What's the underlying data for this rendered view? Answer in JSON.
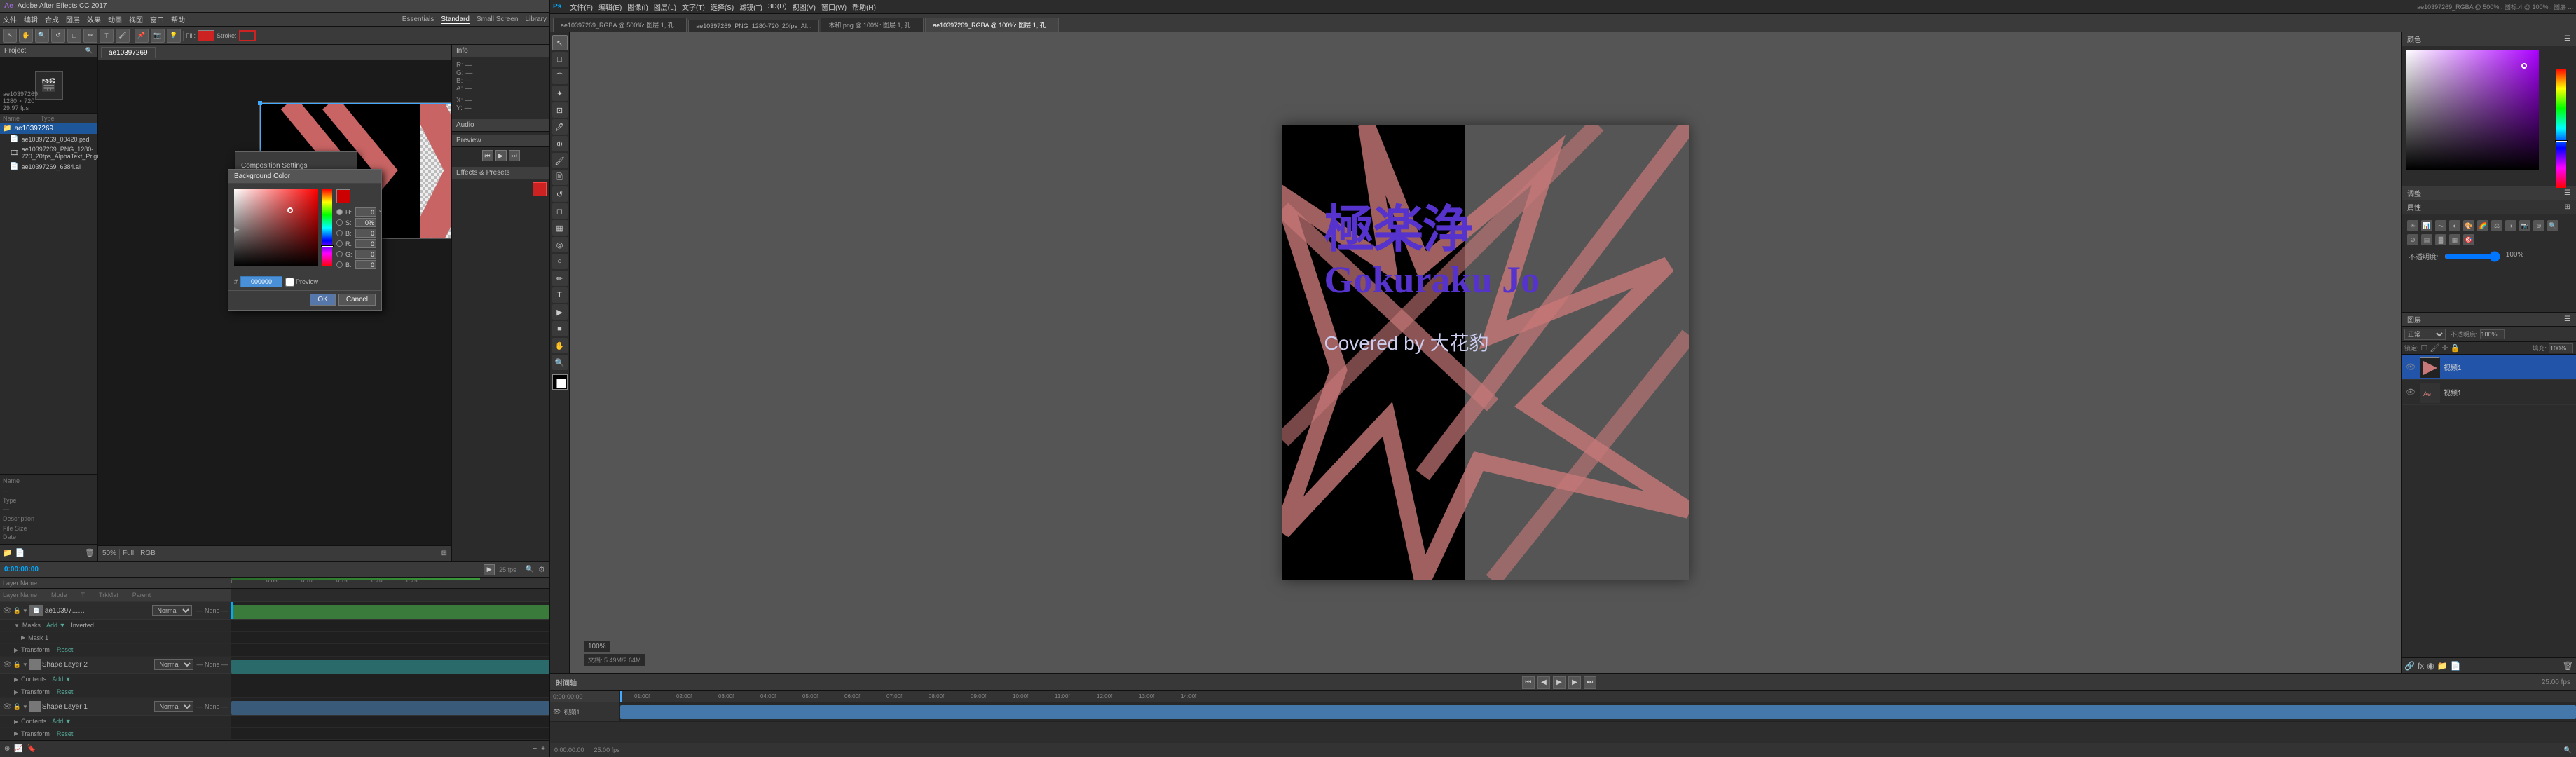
{
  "ae": {
    "title": "Adobe After Effects CC 2017",
    "menu": [
      "文件",
      "编辑",
      "合成",
      "图层",
      "效果",
      "动画",
      "视图",
      "窗口",
      "帮助"
    ],
    "tabs": {
      "project": "ae10397269",
      "comp": "ae10397269"
    },
    "toolbar_label": "Essentials",
    "workspace_options": [
      "Essentials",
      "Standard",
      "Small Screen",
      "Library"
    ],
    "project_items": [
      {
        "name": "ae10397269",
        "type": "folder",
        "icon": "📁"
      },
      {
        "name": "ae10397269_00420.psd",
        "type": "file",
        "icon": "📄"
      },
      {
        "name": "ae10397269_PNG_1280-720_20fps_AlphaText_Pr.gif",
        "type": "file",
        "icon": "🎞"
      },
      {
        "name": "ae10397269_6384.ai",
        "type": "file",
        "icon": "📄"
      }
    ],
    "composition": {
      "name": "ae10397269",
      "size": "1280 × 720",
      "fps": "29.97 fps"
    },
    "timeline": {
      "time": "0:00:00:00",
      "layers": [
        {
          "id": 1,
          "name": "ae10397...00420.psd",
          "mode": "Normal",
          "opacity": "None",
          "parent": "None",
          "color": "#4a7a9b",
          "sub_layers": [
            "Mask",
            "Mask 1",
            "Transform"
          ]
        },
        {
          "id": 2,
          "name": "Shape Layer 2",
          "mode": "Normal",
          "color": "#4a7a9b"
        },
        {
          "id": 3,
          "name": "Shape Layer 1",
          "mode": "Normal",
          "color": "#4a7a9b"
        }
      ]
    },
    "color_picker": {
      "title": "Background Color",
      "ok_label": "OK",
      "cancel_label": "Cancel",
      "hex_value": "000000",
      "fields": [
        {
          "radio": true,
          "label": "H:",
          "value": "0"
        },
        {
          "radio": false,
          "label": "S:",
          "value": "0%"
        },
        {
          "radio": false,
          "label": "B:",
          "value": "0%"
        },
        {
          "radio": false,
          "label": "R:",
          "value": "0"
        },
        {
          "radio": false,
          "label": "G:",
          "value": "0"
        },
        {
          "radio": false,
          "label": "B:",
          "value": "0"
        }
      ]
    },
    "comp_settings_label": "Composition Settings"
  },
  "ps": {
    "title": "Adobe Photoshop",
    "menu": [
      "文件(F)",
      "编辑(E)",
      "图像(I)",
      "图层(L)",
      "文字(T)",
      "选择(S)",
      "滤镜(T)",
      "3D(D)",
      "视图(V)",
      "窗口(W)",
      "帮助(H)"
    ],
    "tabs": [
      "ae10397269_RGBA @ 500%: 图层 1, 孔...",
      "ae10397269_PNG_1280-720_20fps_Al...",
      "木和.png @ 100%: 图层 1, 孔...",
      "ae10397269_RGBA @ 100%: 图层 1, 孔..."
    ],
    "canvas": {
      "jp_text": "極楽浄",
      "en_text": "Gokuraku Jo",
      "sub_text": "Covered by 大花豹"
    },
    "panels": {
      "color_label": "颜色",
      "adjustments_label": "调整",
      "properties_label": "属性",
      "layers_label": "图层"
    },
    "layers": [
      {
        "name": "视频1",
        "visible": true,
        "selected": true
      },
      {
        "name": "视频1",
        "visible": true,
        "selected": false
      }
    ],
    "timeline": {
      "fps": "25.00 fps",
      "time": "0:00:00:00",
      "duration": "14:00"
    }
  }
}
